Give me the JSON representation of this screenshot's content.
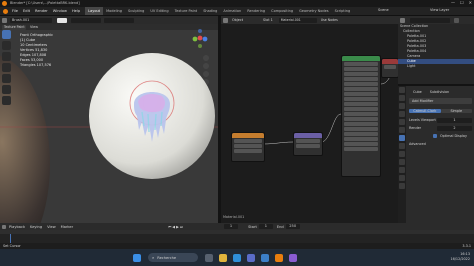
{
  "window": {
    "title": "Blender* [C:\\Users\\...\\PolettaBRK.blend]",
    "minimize": "—",
    "maximize": "☐",
    "close": "✕"
  },
  "menu": [
    "File",
    "Edit",
    "Render",
    "Window",
    "Help"
  ],
  "workspaces": [
    "Layout",
    "Modeling",
    "Sculpting",
    "UV Editing",
    "Texture Paint",
    "Shading",
    "Animation",
    "Rendering",
    "Compositing",
    "Geometry Nodes",
    "Scripting"
  ],
  "active_workspace": "Layout",
  "scene_label": "Scene",
  "view_layer_label": "View Layer",
  "viewport": {
    "brush_name": "Brush.001",
    "mode": "Texture Paint",
    "view_menu": "View",
    "info": [
      "Front Orthographic",
      "(1) Cube",
      "10 Centimeters",
      "Vertices  51,830",
      "Edges  107,808",
      "Faces  53,000",
      "Triangles  107,576"
    ]
  },
  "node_editor": {
    "object_menu": "Object",
    "slot": "Slot 1",
    "material": "Material.001",
    "use_nodes": "Use Nodes",
    "material_label": "Material.001"
  },
  "outliner": {
    "header": "Scene Collection",
    "rows": [
      "Scene Collection",
      "Collection",
      "Poletta.001",
      "Poletta.002",
      "Poletta.003",
      "Poletta.004",
      "Camera",
      "Cube",
      "Light"
    ]
  },
  "properties": {
    "object": "Cube",
    "modifier_name": "Subdivision",
    "add_modifier": "Add Modifier",
    "tabs": [
      "Catmull-Clark",
      "Simple"
    ],
    "levels_viewport_label": "Levels Viewport",
    "levels_viewport_value": "1",
    "render_label": "Render",
    "render_value": "2",
    "optimal_display": "Optimal Display",
    "advanced": "Advanced"
  },
  "timeline": {
    "playback": "Playback",
    "keying": "Keying",
    "view": "View",
    "marker": "Marker",
    "current_frame": "1",
    "start_label": "Start",
    "start": "1",
    "end_label": "End",
    "end": "250"
  },
  "status": {
    "left": "Set Cursor",
    "right": "3.3.1"
  },
  "taskbar": {
    "search": "Recherche",
    "time": "16:13",
    "date": "16/12/2022"
  },
  "colors": {
    "accent": "#4772b3",
    "sphere_glow": "#d96a6a",
    "node_orange": "#c57d2e",
    "node_green": "#3a8b4a",
    "node_purple": "#6b5fa5"
  }
}
